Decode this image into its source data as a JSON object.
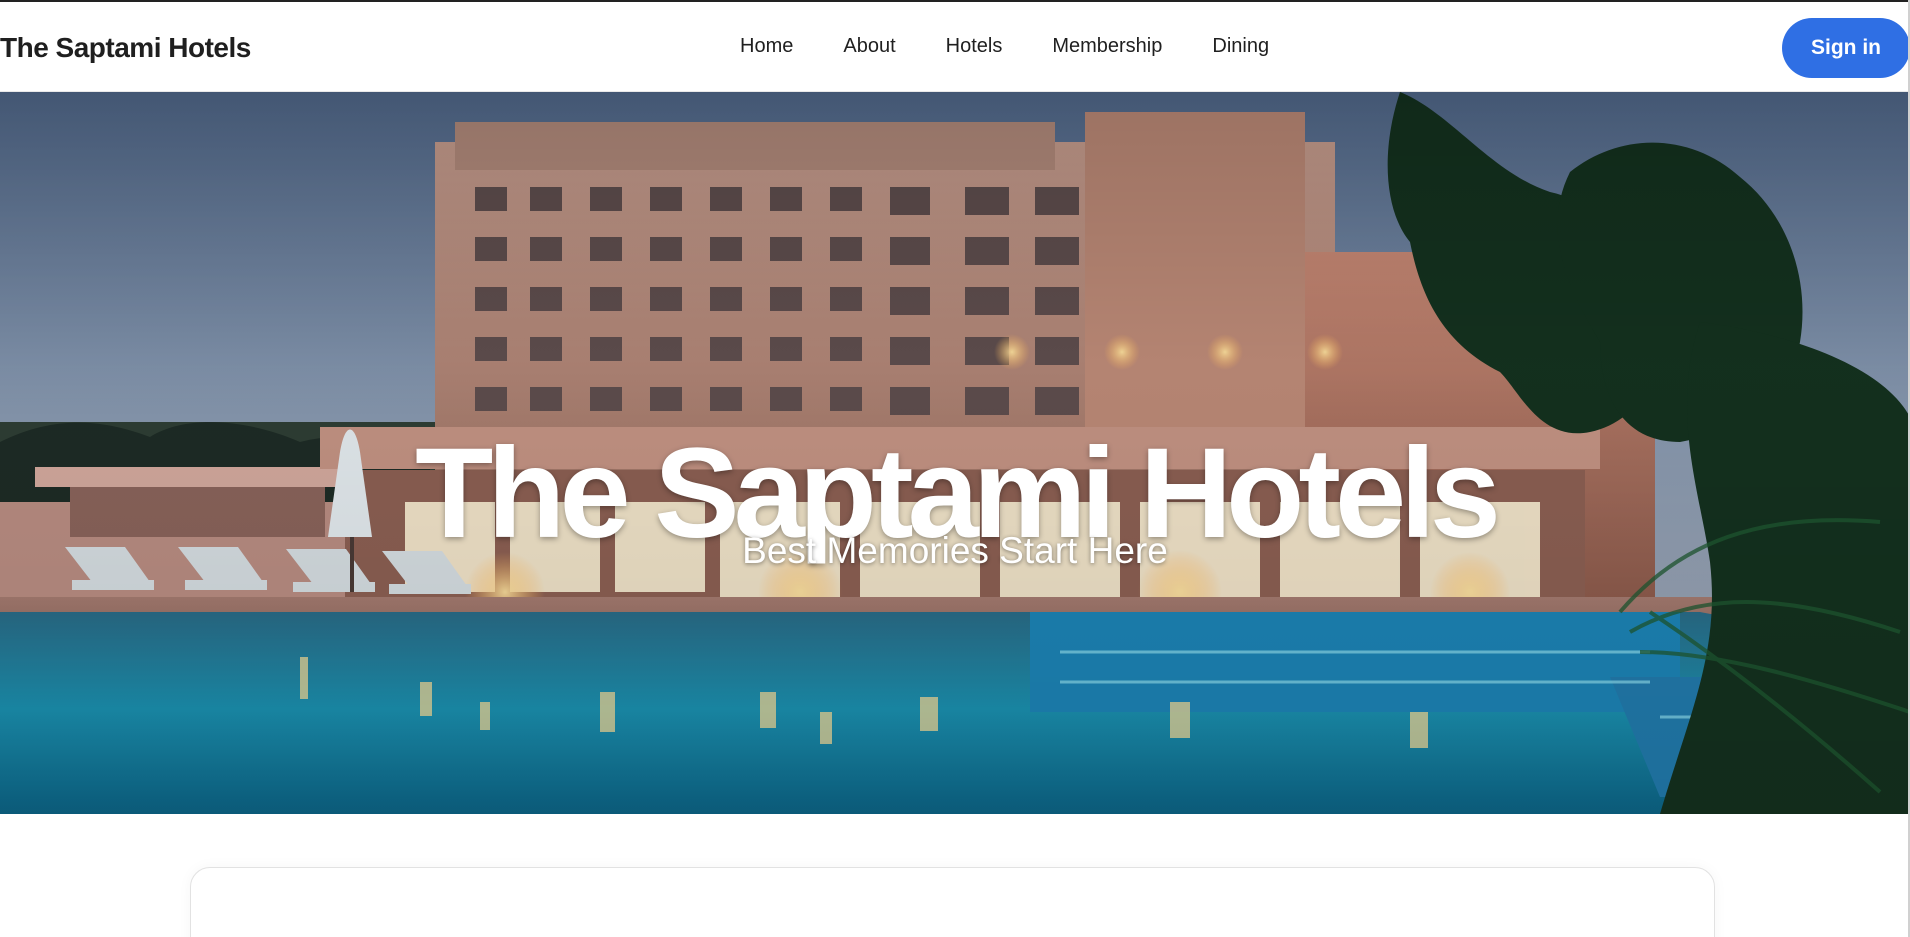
{
  "brand": {
    "name": "The Saptami Hotels"
  },
  "nav": {
    "items": [
      {
        "label": "Home"
      },
      {
        "label": "About"
      },
      {
        "label": "Hotels"
      },
      {
        "label": "Membership"
      },
      {
        "label": "Dining"
      }
    ]
  },
  "header": {
    "signin_label": "Sign in"
  },
  "hero": {
    "title": "The Saptami Hotels",
    "subtitle": "Best Memories Start Here"
  },
  "colors": {
    "accent": "#2f6fe4",
    "text": "#1f1f1f",
    "hero_text": "#ffffff"
  }
}
